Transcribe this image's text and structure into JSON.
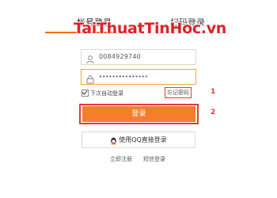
{
  "tabs": {
    "account_login": "帐号登录",
    "qr_login": "扫码登录"
  },
  "watermark": "TaiThuatTinHoc.vn",
  "form": {
    "account_value": "0084929740",
    "password_value": "•••••••••••••••",
    "remember_label": "下次自动登录",
    "remember_checked": true,
    "forgot_label": "忘记密码",
    "login_label": "登录",
    "qq_login_label": "使用QQ直接登录"
  },
  "annotations": {
    "marker_1": "1",
    "marker_2": "2"
  },
  "links": {
    "register": "立即注册",
    "sms_login": "短信登录"
  },
  "colors": {
    "accent": "#f57e2c",
    "annotation": "#e53935",
    "watermark": "#e21f26"
  },
  "icons": [
    "user-icon",
    "lock-icon",
    "qq-penguin-icon"
  ]
}
